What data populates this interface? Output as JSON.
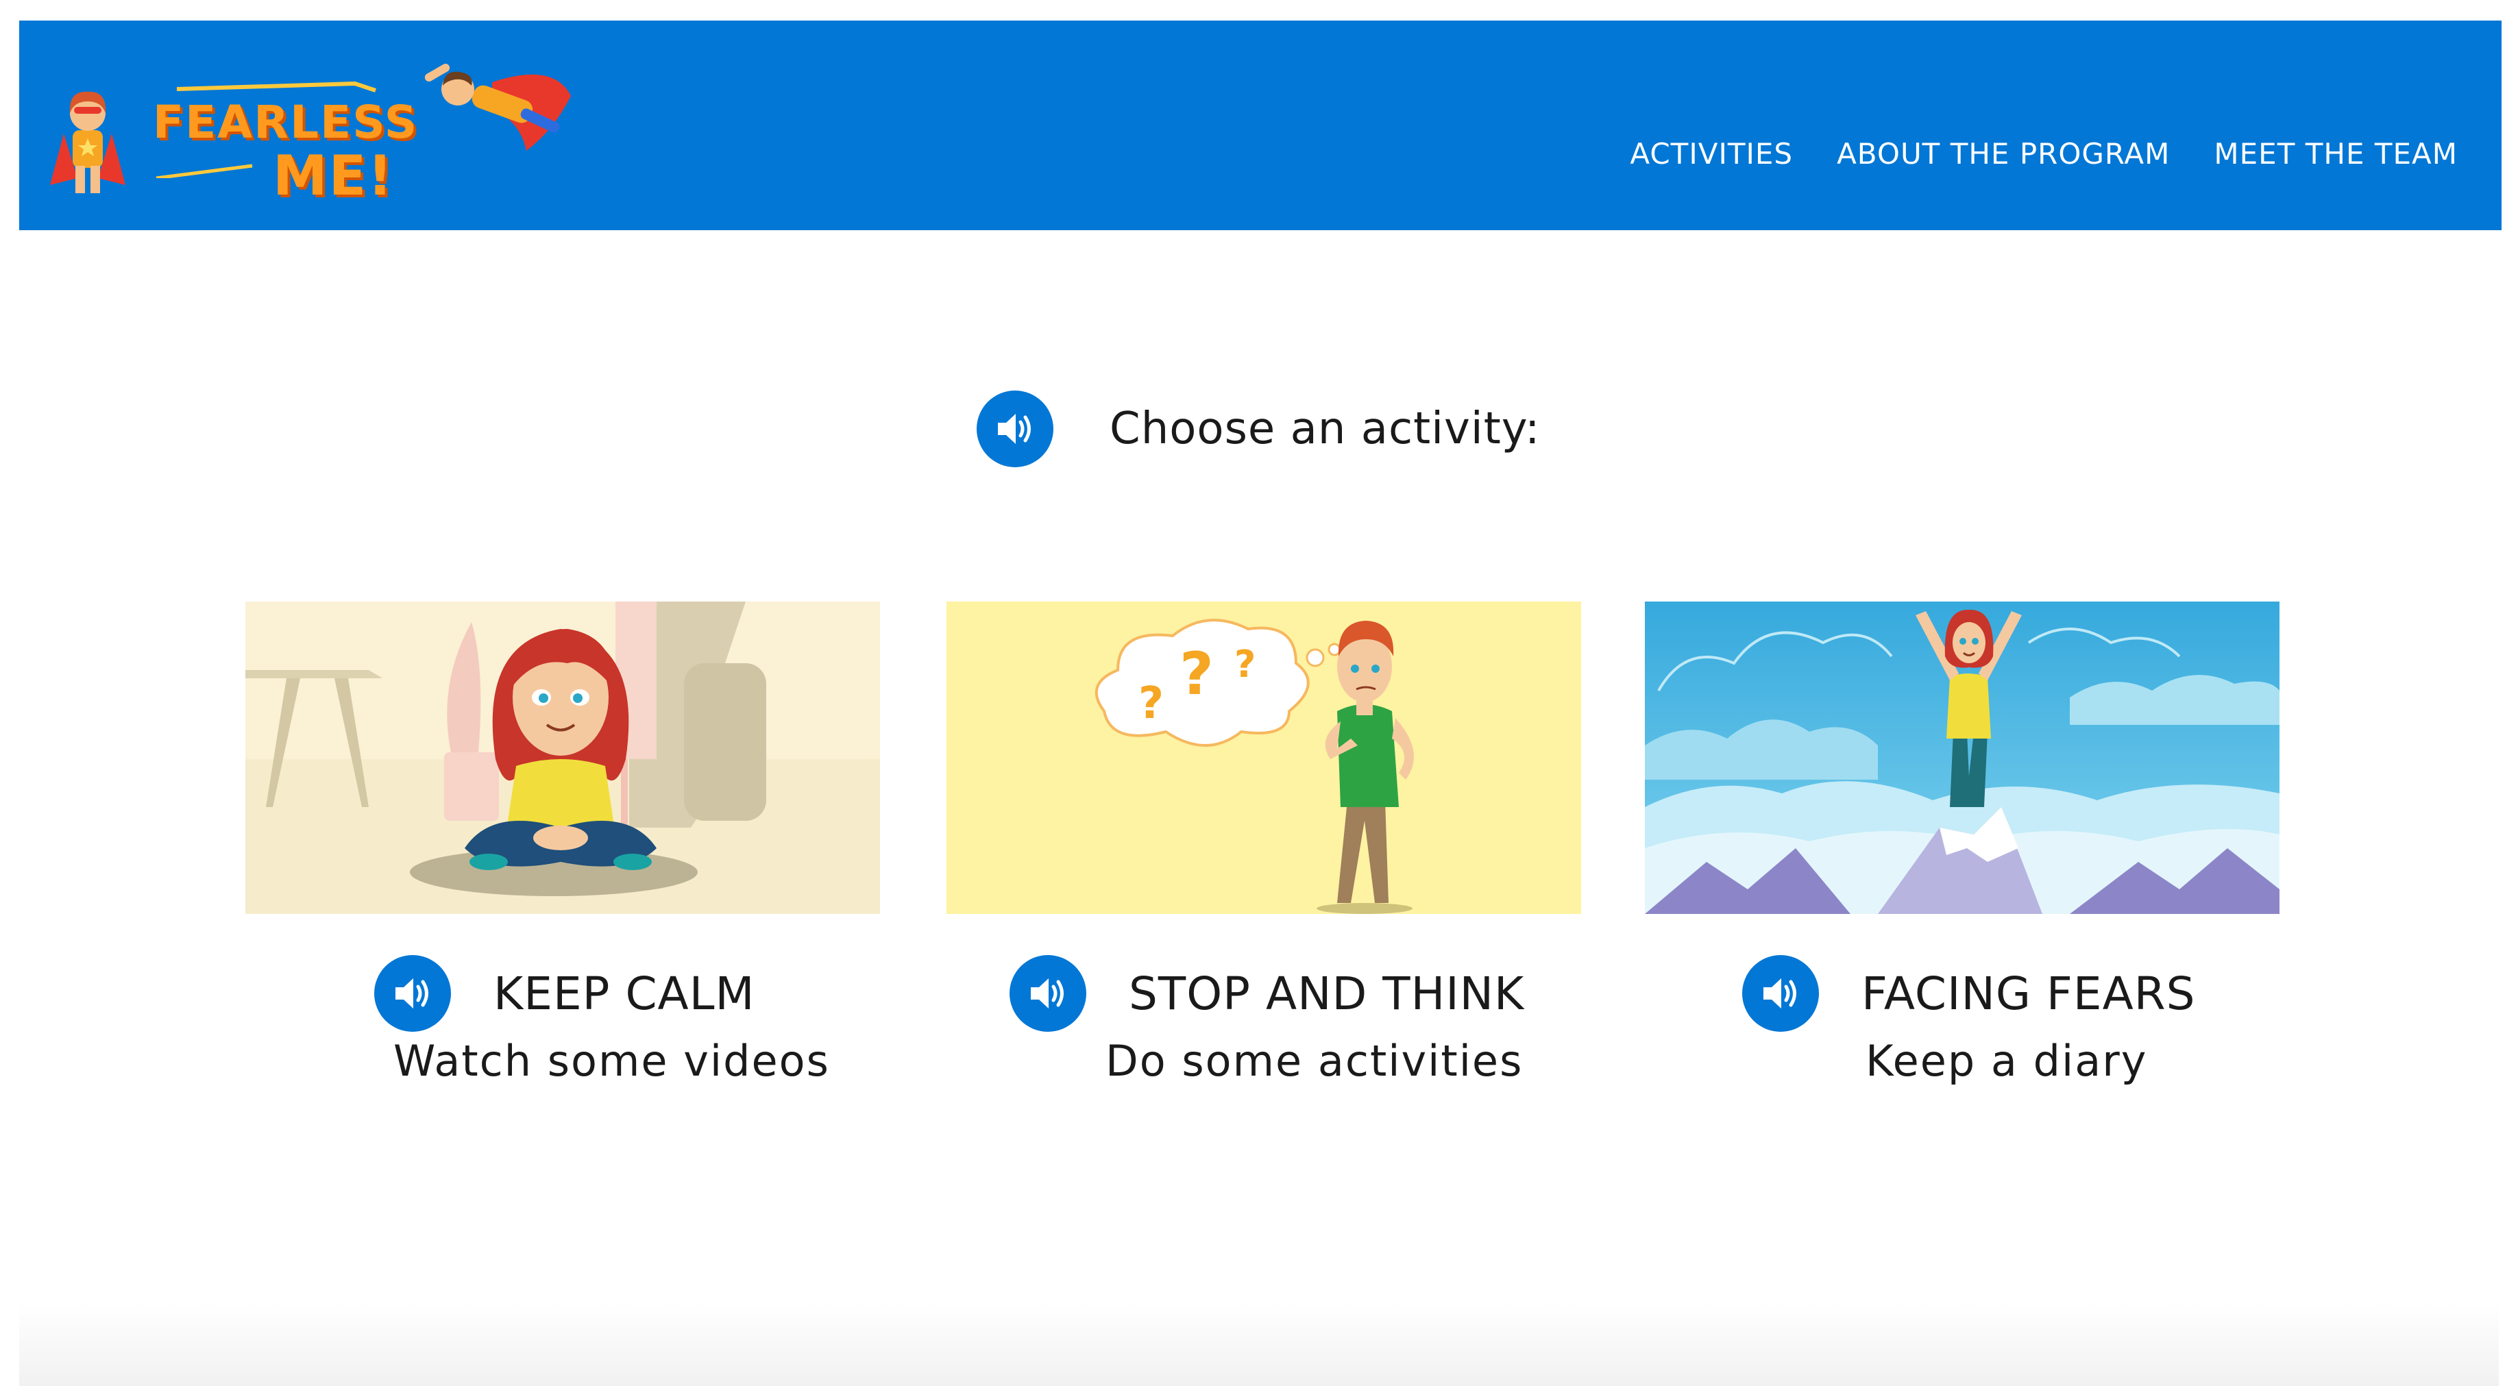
{
  "header": {
    "logo": {
      "line1": "FEARLESS",
      "line2": "ME!"
    },
    "nav": [
      {
        "label": "ACTIVITIES"
      },
      {
        "label": "ABOUT THE PROGRAM"
      },
      {
        "label": "MEET THE TEAM"
      }
    ],
    "background_color": "#0277d6"
  },
  "main": {
    "heading": "Choose an activity:",
    "heading_icon": "speaker-icon",
    "cards": [
      {
        "title": "KEEP CALM",
        "subtitle": "Watch some videos",
        "icon": "speaker-icon",
        "image": "meditating-girl-illustration"
      },
      {
        "title": "STOP AND THINK",
        "subtitle": "Do some activities",
        "icon": "speaker-icon",
        "image": "thinking-boy-illustration"
      },
      {
        "title": "FACING FEARS",
        "subtitle": "Keep a diary",
        "icon": "speaker-icon",
        "image": "girl-on-mountain-illustration"
      }
    ]
  },
  "colors": {
    "accent": "#0277d6",
    "logo_orange": "#ff9a1f",
    "text": "#1a1a1a"
  }
}
